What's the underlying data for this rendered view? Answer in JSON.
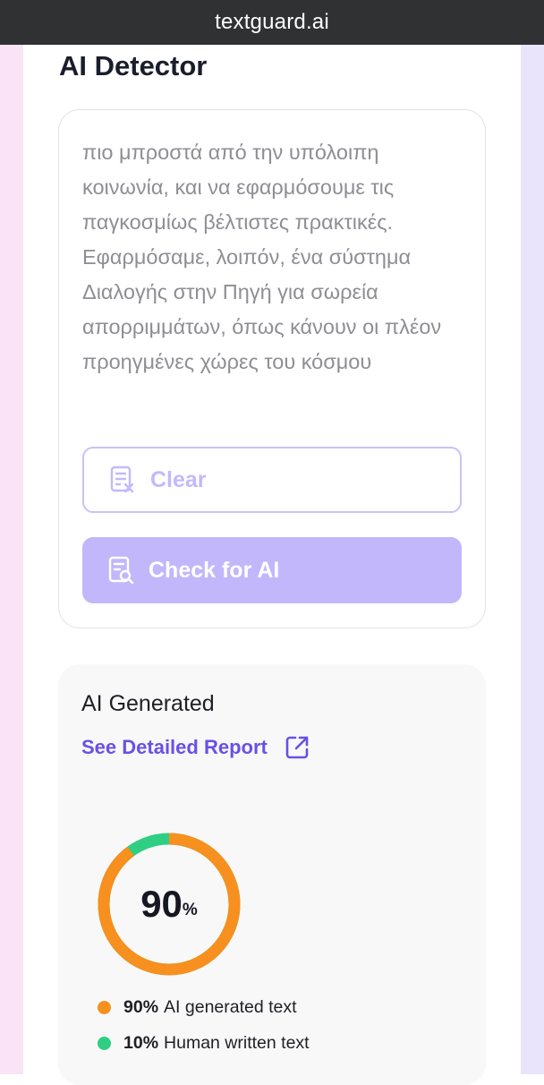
{
  "browser": {
    "url": "textguard.ai"
  },
  "page": {
    "title": "AI Detector"
  },
  "editor": {
    "text": "πιο μπροστά από την υπόλοιπη κοινωνία, και να εφαρμόσουμε τις παγκοσμίως βέλτιστες πρακτικές. Εφαρμόσαμε, λοιπόν, ένα σύστημα Διαλογής στην Πηγή για σωρεία απορριμμάτων, όπως κάνουν οι πλέον προηγμένες χώρες του κόσμου"
  },
  "buttons": {
    "clear_label": "Clear",
    "clear_icon": "document-clear-icon",
    "check_label": "Check for AI",
    "check_icon": "document-search-icon"
  },
  "result": {
    "label": "AI Generated",
    "report_link": "See Detailed Report",
    "report_icon": "external-link-icon",
    "score": "90",
    "score_unit": "%",
    "ai_fraction": 0.9,
    "legend": [
      {
        "value": "90%",
        "label": "AI generated text",
        "color": "#f7901e"
      },
      {
        "value": "10%",
        "label": "Human written text",
        "color": "#2ecf82"
      }
    ]
  },
  "colors": {
    "accent": "#6a50e6",
    "button_fill": "#c2b7fb",
    "ai": "#f7901e",
    "human": "#2ecf82"
  }
}
